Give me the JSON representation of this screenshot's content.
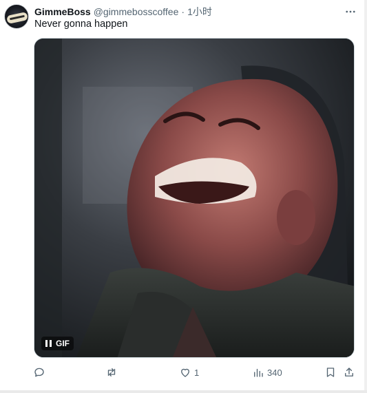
{
  "tweet": {
    "display_name": "GimmeBoss",
    "handle": "@gimmebosscoffee",
    "separator": "·",
    "time": "1小时",
    "text": "Never gonna happen",
    "more_icon": "more-icon"
  },
  "media": {
    "type": "gif",
    "gif_label": "GIF",
    "description_icon": "laughing-man-gif"
  },
  "actions": {
    "reply_count": "",
    "retweet_count": "",
    "like_count": "1",
    "views_count": "340"
  },
  "colors": {
    "text_primary": "#0f1419",
    "text_secondary": "#536471",
    "border": "#cfd9de"
  }
}
